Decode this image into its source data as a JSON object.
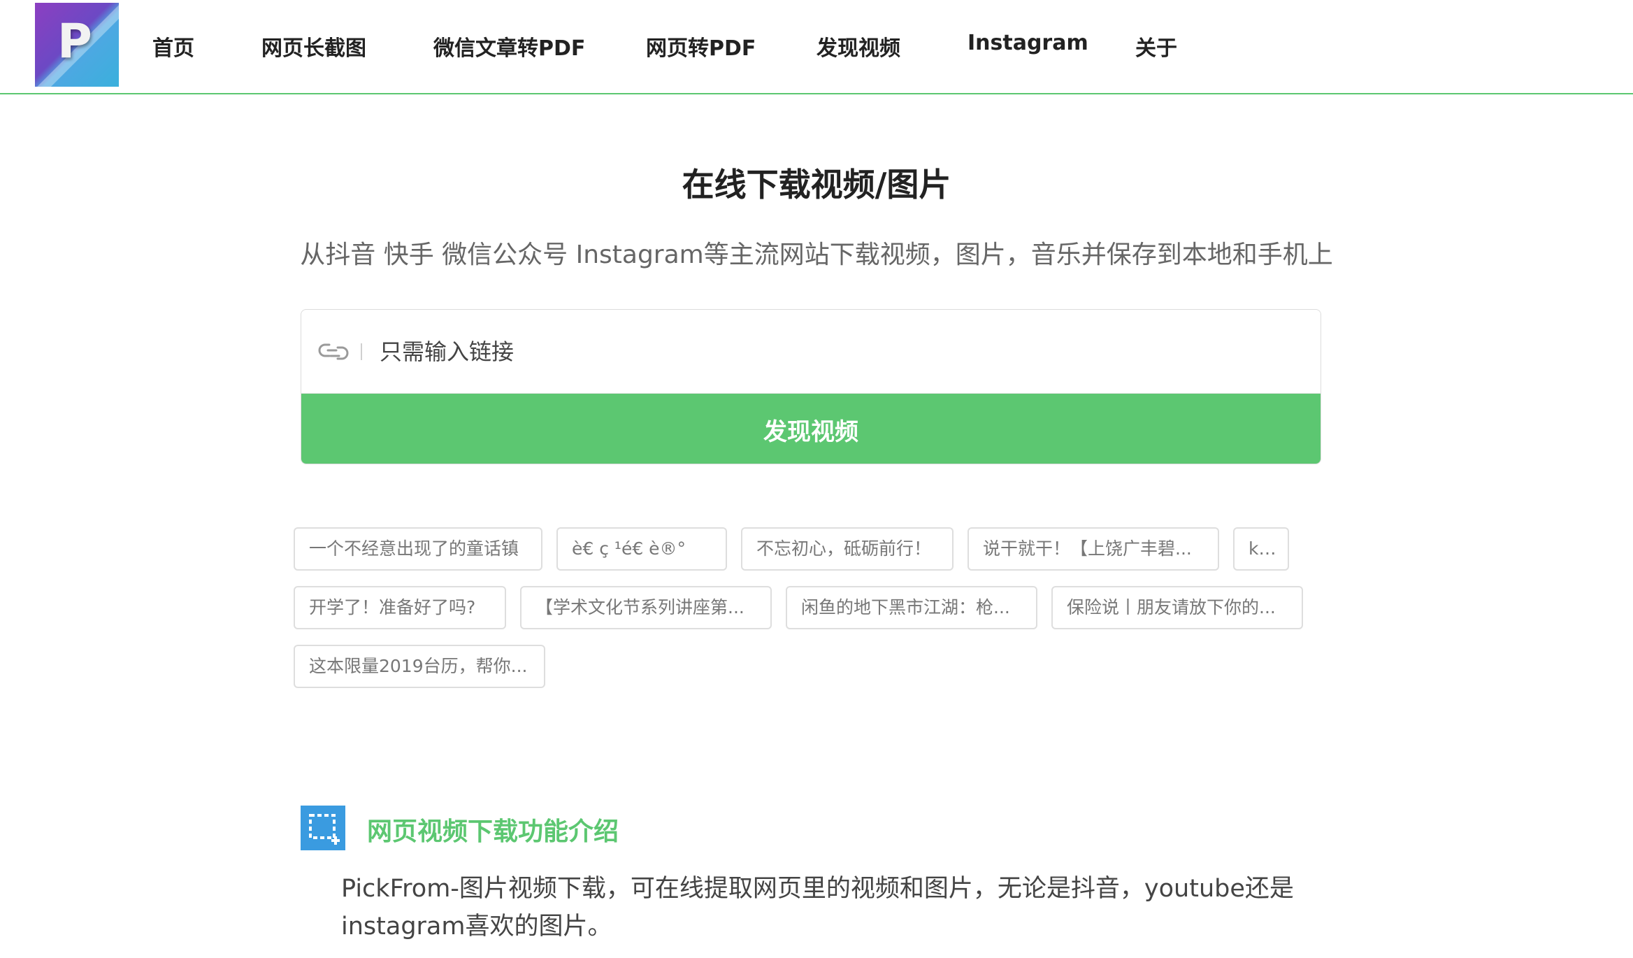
{
  "logo": {
    "letter": "P"
  },
  "nav": {
    "items": [
      {
        "label": "首页"
      },
      {
        "label": "网页长截图"
      },
      {
        "label": "微信文章转PDF"
      },
      {
        "label": "网页转PDF"
      },
      {
        "label": "发现视频"
      },
      {
        "label": "Instagram"
      },
      {
        "label": "关于"
      }
    ]
  },
  "hero": {
    "title": "在线下载视频/图片",
    "subtitle": "从抖音 快手 微信公众号 Instagram等主流网站下载视频，图片，音乐并保存到本地和手机上"
  },
  "search": {
    "icon": "link-icon",
    "placeholder": "只需输入链接",
    "value": "",
    "button_label": "发现视频"
  },
  "tags": [
    "一个不经意出现了的童话镇",
    "è€  ç  ¹é€  è®°",
    "不忘初心，砥砺前行！",
    "说干就干！【上饶广丰碧...",
    "kdl",
    "开学了！准备好了吗?",
    "【学术文化节系列讲座第...",
    "闲鱼的地下黑市江湖：枪...",
    "保险说丨朋友请放下你的...",
    "这本限量2019台历，帮你..."
  ],
  "feature": {
    "icon": "screenshot-crop-icon",
    "title": "网页视频下载功能介绍",
    "description": "PickFrom-图片视频下载，可在线提取网页里的视频和图片，无论是抖音，youtube还是instagram喜欢的图片。"
  },
  "colors": {
    "accent": "#5cc771",
    "icon_blue": "#3a9be0"
  }
}
